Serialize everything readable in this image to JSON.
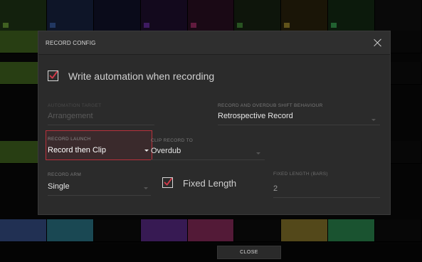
{
  "modal": {
    "title": "RECORD CONFIG",
    "close_icon": "close-icon",
    "write_automation": {
      "label": "Write automation when recording",
      "checked": true
    },
    "automation_target": {
      "label": "AUTOMATION TARGET",
      "value": "Arrangement",
      "disabled": true
    },
    "shift_behaviour": {
      "label": "RECORD AND OVERDUB SHIFT BEHAVIOUR",
      "value": "Retrospective Record"
    },
    "record_launch": {
      "label": "RECORD LAUNCH",
      "value": "Record then Clip",
      "focused": true
    },
    "clip_record_to": {
      "label": "CLIP RECORD TO",
      "value": "Overdub"
    },
    "record_arm": {
      "label": "RECORD ARM",
      "value": "Single"
    },
    "fixed_length": {
      "label": "Fixed Length",
      "checked": true
    },
    "fixed_length_bars": {
      "label": "FIXED LENGTH (BARS)",
      "value": "2"
    }
  },
  "footer": {
    "close_label": "CLOSE"
  },
  "colors": {
    "accent": "#d23a4a",
    "modal_bg": "#2b2b2b"
  }
}
